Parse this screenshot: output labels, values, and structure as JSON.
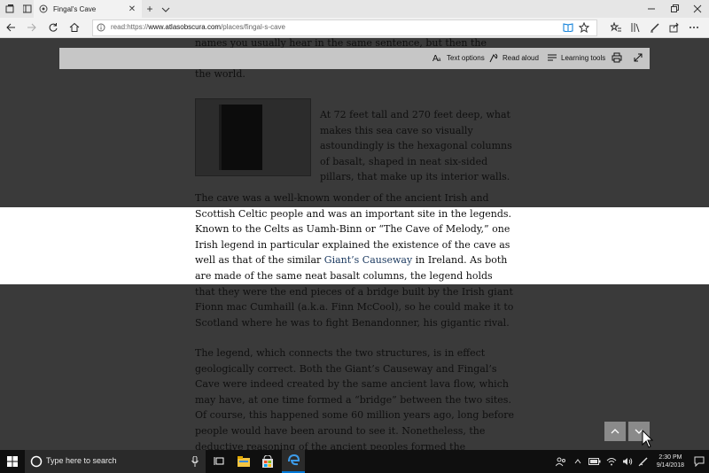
{
  "tab": {
    "title": "Fingal's Cave"
  },
  "address": {
    "prefix": "read:https://",
    "domain": "www.atlasobscura.com",
    "path": "/places/fingal-s-cave"
  },
  "reader_toolbar": {
    "text_options": "Text options",
    "read_aloud": "Read aloud",
    "learning_tools": "Learning tools"
  },
  "article": {
    "p0": "names you usually hear in the same sentence, but then the place that bears a history and geology unlike any other cave in the world.",
    "p1": "At 72 feet tall and 270 feet deep, what makes this sea cave so visually astoundingly is the hexagonal columns of basalt, shaped in neat six-sided pillars, that make up its interior walls.",
    "p2a": "The cave was a well-known wonder of the ancient Irish and Scottish Celtic people and was an important site in the legends. Known to the Celts as Uamh-Binn or “The Cave of Melody,” one Irish legend in particular explained the existence of the cave as well as that of the similar ",
    "p2link": "Giant’s Causeway",
    "p2b": " in Ireland. As both are made of the same neat basalt columns, the legend holds that they were the end pieces of a bridge built by the Irish giant Fionn mac Cumhaill (a.k.a. Finn McCool), so he could make it to Scotland where he was to fight Benandonner, his gigantic rival.",
    "p3": "The legend, which connects the two structures, is in effect geologically correct. Both the Giant’s Causeway and Fingal’s Cave were indeed created by the same ancient lava flow, which may have, at one time formed a “bridge” between the two sites. Of course, this happened some 60 million years ago, long before people would have been around to see it. Nonetheless, the deductive reasoning of the ancient peoples formed the connection and base of the legend that the"
  },
  "taskbar": {
    "search_placeholder": "Type here to search",
    "time": "2:30 PM",
    "date": "9/14/2018"
  },
  "colors": {
    "accent": "#0078d7",
    "link": "#1e3c62",
    "dim_background": "#3a3a3a"
  }
}
